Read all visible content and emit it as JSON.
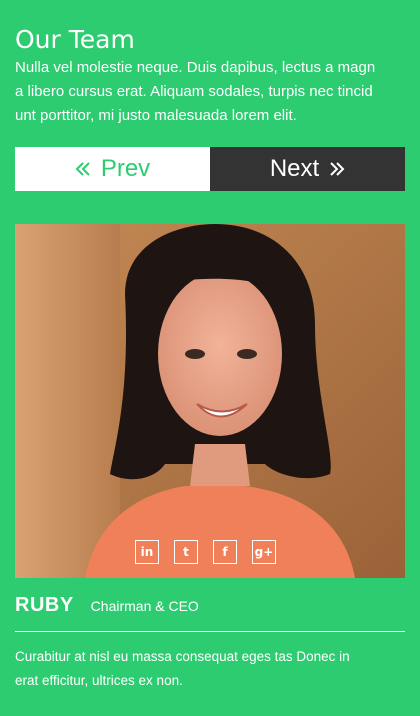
{
  "section": {
    "title": "Our Team",
    "intro_lines": [
      "Nulla vel molestie neque. Duis dapibus, lectus a magn",
      "a libero cursus erat. Aliquam sodales, turpis nec tincid",
      "unt porttitor, mi justo malesuada lorem elit."
    ]
  },
  "nav": {
    "prev_label": "Prev",
    "next_label": "Next",
    "prev_icon": "double-chevron-left-icon",
    "next_icon": "double-chevron-right-icon"
  },
  "member": {
    "name": "RUBY",
    "role": "Chairman & CEO",
    "bio_lines": [
      "Curabitur at nisl eu massa consequat eges tas Donec in",
      "erat efficitur, ultrices ex non."
    ],
    "social": [
      {
        "icon": "linkedin-icon",
        "glyph": "in"
      },
      {
        "icon": "twitter-icon",
        "glyph": "t"
      },
      {
        "icon": "facebook-icon",
        "glyph": "f"
      },
      {
        "icon": "google-plus-icon",
        "glyph": "g+"
      }
    ]
  },
  "colors": {
    "background": "#2ecc71",
    "next_button": "#333333",
    "prev_button": "#ffffff"
  }
}
